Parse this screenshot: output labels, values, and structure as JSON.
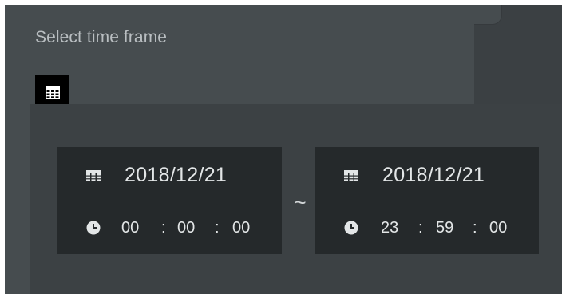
{
  "panel": {
    "title": "Select time frame",
    "calendar_toggle_icon": "calendar-icon"
  },
  "range": {
    "separator": "~",
    "start": {
      "date": "2018/12/21",
      "hour": "00",
      "minute": "00",
      "second": "00",
      "date_icon": "calendar-icon",
      "time_icon": "clock-icon"
    },
    "end": {
      "date": "2018/12/21",
      "hour": "23",
      "minute": "59",
      "second": "00",
      "date_icon": "calendar-icon",
      "time_icon": "clock-icon"
    },
    "time_separator": ":"
  },
  "colors": {
    "panel_bg": "#464c4f",
    "dropdown_bg": "#3c4144",
    "box_bg": "#25292b",
    "text_light": "#e3e6e7",
    "title_text": "#b9bec1"
  }
}
